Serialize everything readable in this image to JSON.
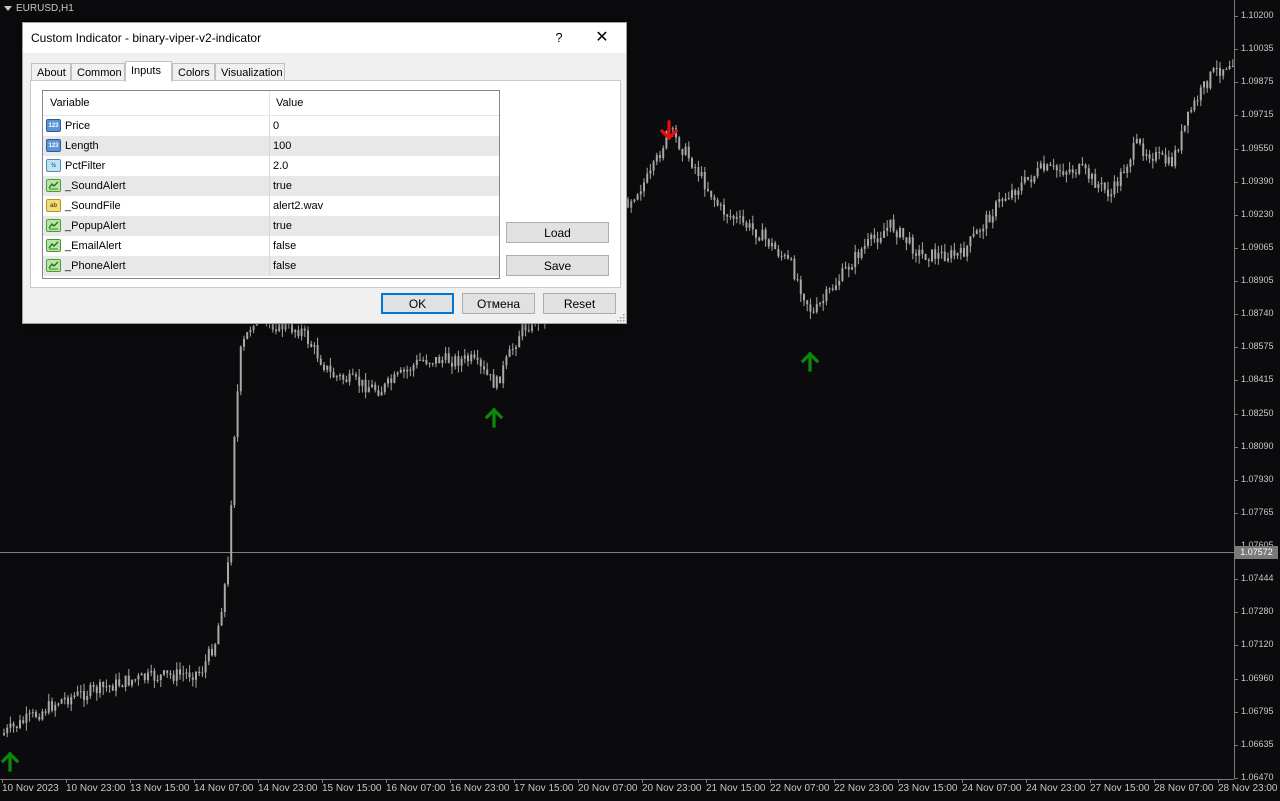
{
  "chart": {
    "symbol_label": "EURUSD,H1",
    "current_price": "1.07572",
    "price_ticks": [
      "1.10200",
      "1.10035",
      "1.09875",
      "1.09715",
      "1.09550",
      "1.09390",
      "1.09230",
      "1.09065",
      "1.08905",
      "1.08740",
      "1.08575",
      "1.08415",
      "1.08250",
      "1.08090",
      "1.07930",
      "1.07765",
      "1.07605",
      "1.07444",
      "1.07280",
      "1.07120",
      "1.06960",
      "1.06795",
      "1.06635",
      "1.06470"
    ],
    "time_ticks": [
      "10 Nov 2023",
      "10 Nov 23:00",
      "13 Nov 15:00",
      "14 Nov 07:00",
      "14 Nov 23:00",
      "15 Nov 15:00",
      "16 Nov 07:00",
      "16 Nov 23:00",
      "17 Nov 15:00",
      "20 Nov 07:00",
      "20 Nov 23:00",
      "21 Nov 15:00",
      "22 Nov 07:00",
      "22 Nov 23:00",
      "23 Nov 15:00",
      "24 Nov 07:00",
      "24 Nov 23:00",
      "27 Nov 15:00",
      "28 Nov 07:00",
      "28 Nov 23:00"
    ],
    "colors": {
      "background": "#0b0b0d",
      "candles": "#a8a8a8",
      "buy_arrow": "#0a8a0a",
      "sell_arrow": "#e01010",
      "crosshair": "#808080"
    },
    "signals": [
      {
        "type": "buy",
        "icon": "arrow-up-icon"
      },
      {
        "type": "buy",
        "icon": "arrow-up-icon"
      },
      {
        "type": "buy",
        "icon": "arrow-up-icon"
      },
      {
        "type": "sell",
        "icon": "arrow-down-icon"
      }
    ]
  },
  "dialog": {
    "title": "Custom Indicator - binary-viper-v2-indicator",
    "help_label": "?",
    "close_label": "✕",
    "tabs": [
      {
        "label": "About",
        "active": false
      },
      {
        "label": "Common",
        "active": false
      },
      {
        "label": "Inputs",
        "active": true
      },
      {
        "label": "Colors",
        "active": false
      },
      {
        "label": "Visualization",
        "active": false
      }
    ],
    "table": {
      "col_variable": "Variable",
      "col_value": "Value",
      "rows": [
        {
          "name": "Price",
          "value": "0",
          "type": "int",
          "icon": "int-type-icon",
          "icon_text": "123"
        },
        {
          "name": "Length",
          "value": "100",
          "type": "int",
          "icon": "int-type-icon",
          "icon_text": "123"
        },
        {
          "name": "PctFilter",
          "value": "2.0",
          "type": "dbl",
          "icon": "double-type-icon",
          "icon_text": "½"
        },
        {
          "name": "_SoundAlert",
          "value": "true",
          "type": "bool",
          "icon": "bool-type-icon",
          "icon_text": ""
        },
        {
          "name": "_SoundFile",
          "value": "alert2.wav",
          "type": "str",
          "icon": "string-type-icon",
          "icon_text": "ab"
        },
        {
          "name": "_PopupAlert",
          "value": "true",
          "type": "bool",
          "icon": "bool-type-icon",
          "icon_text": ""
        },
        {
          "name": "_EmailAlert",
          "value": "false",
          "type": "bool",
          "icon": "bool-type-icon",
          "icon_text": ""
        },
        {
          "name": "_PhoneAlert",
          "value": "false",
          "type": "bool",
          "icon": "bool-type-icon",
          "icon_text": ""
        }
      ]
    },
    "buttons": {
      "load": "Load",
      "save": "Save",
      "ok": "OK",
      "cancel": "Отмена",
      "reset": "Reset"
    }
  }
}
